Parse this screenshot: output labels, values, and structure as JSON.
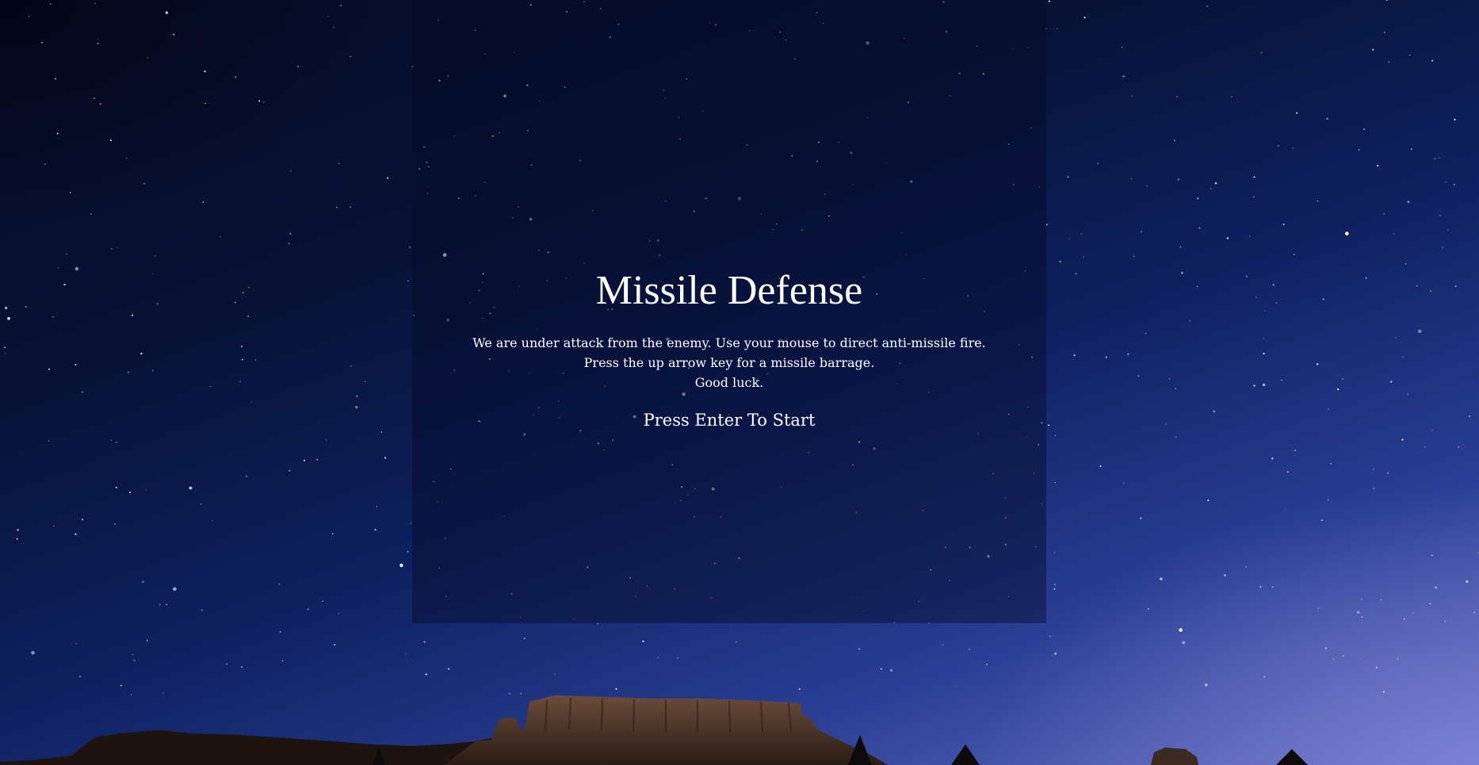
{
  "game": {
    "title": "Missile Defense",
    "instructions": [
      "We are under attack from the enemy. Use your mouse to direct anti-missile fire.",
      "Press the up arrow key for a missile barrage.",
      "Good luck."
    ],
    "start_prompt": "Press Enter To Start"
  },
  "colors": {
    "sky_top": "#050b26",
    "sky_bottom": "#6a72c4",
    "panel_tint": "#040a28",
    "text": "#ffffff",
    "rock": "#3a2a22",
    "rock_highlight": "#6b4c3a"
  },
  "icons": {
    "background": "night-sky-starfield",
    "foreground": "desert-mesa-silhouette"
  }
}
